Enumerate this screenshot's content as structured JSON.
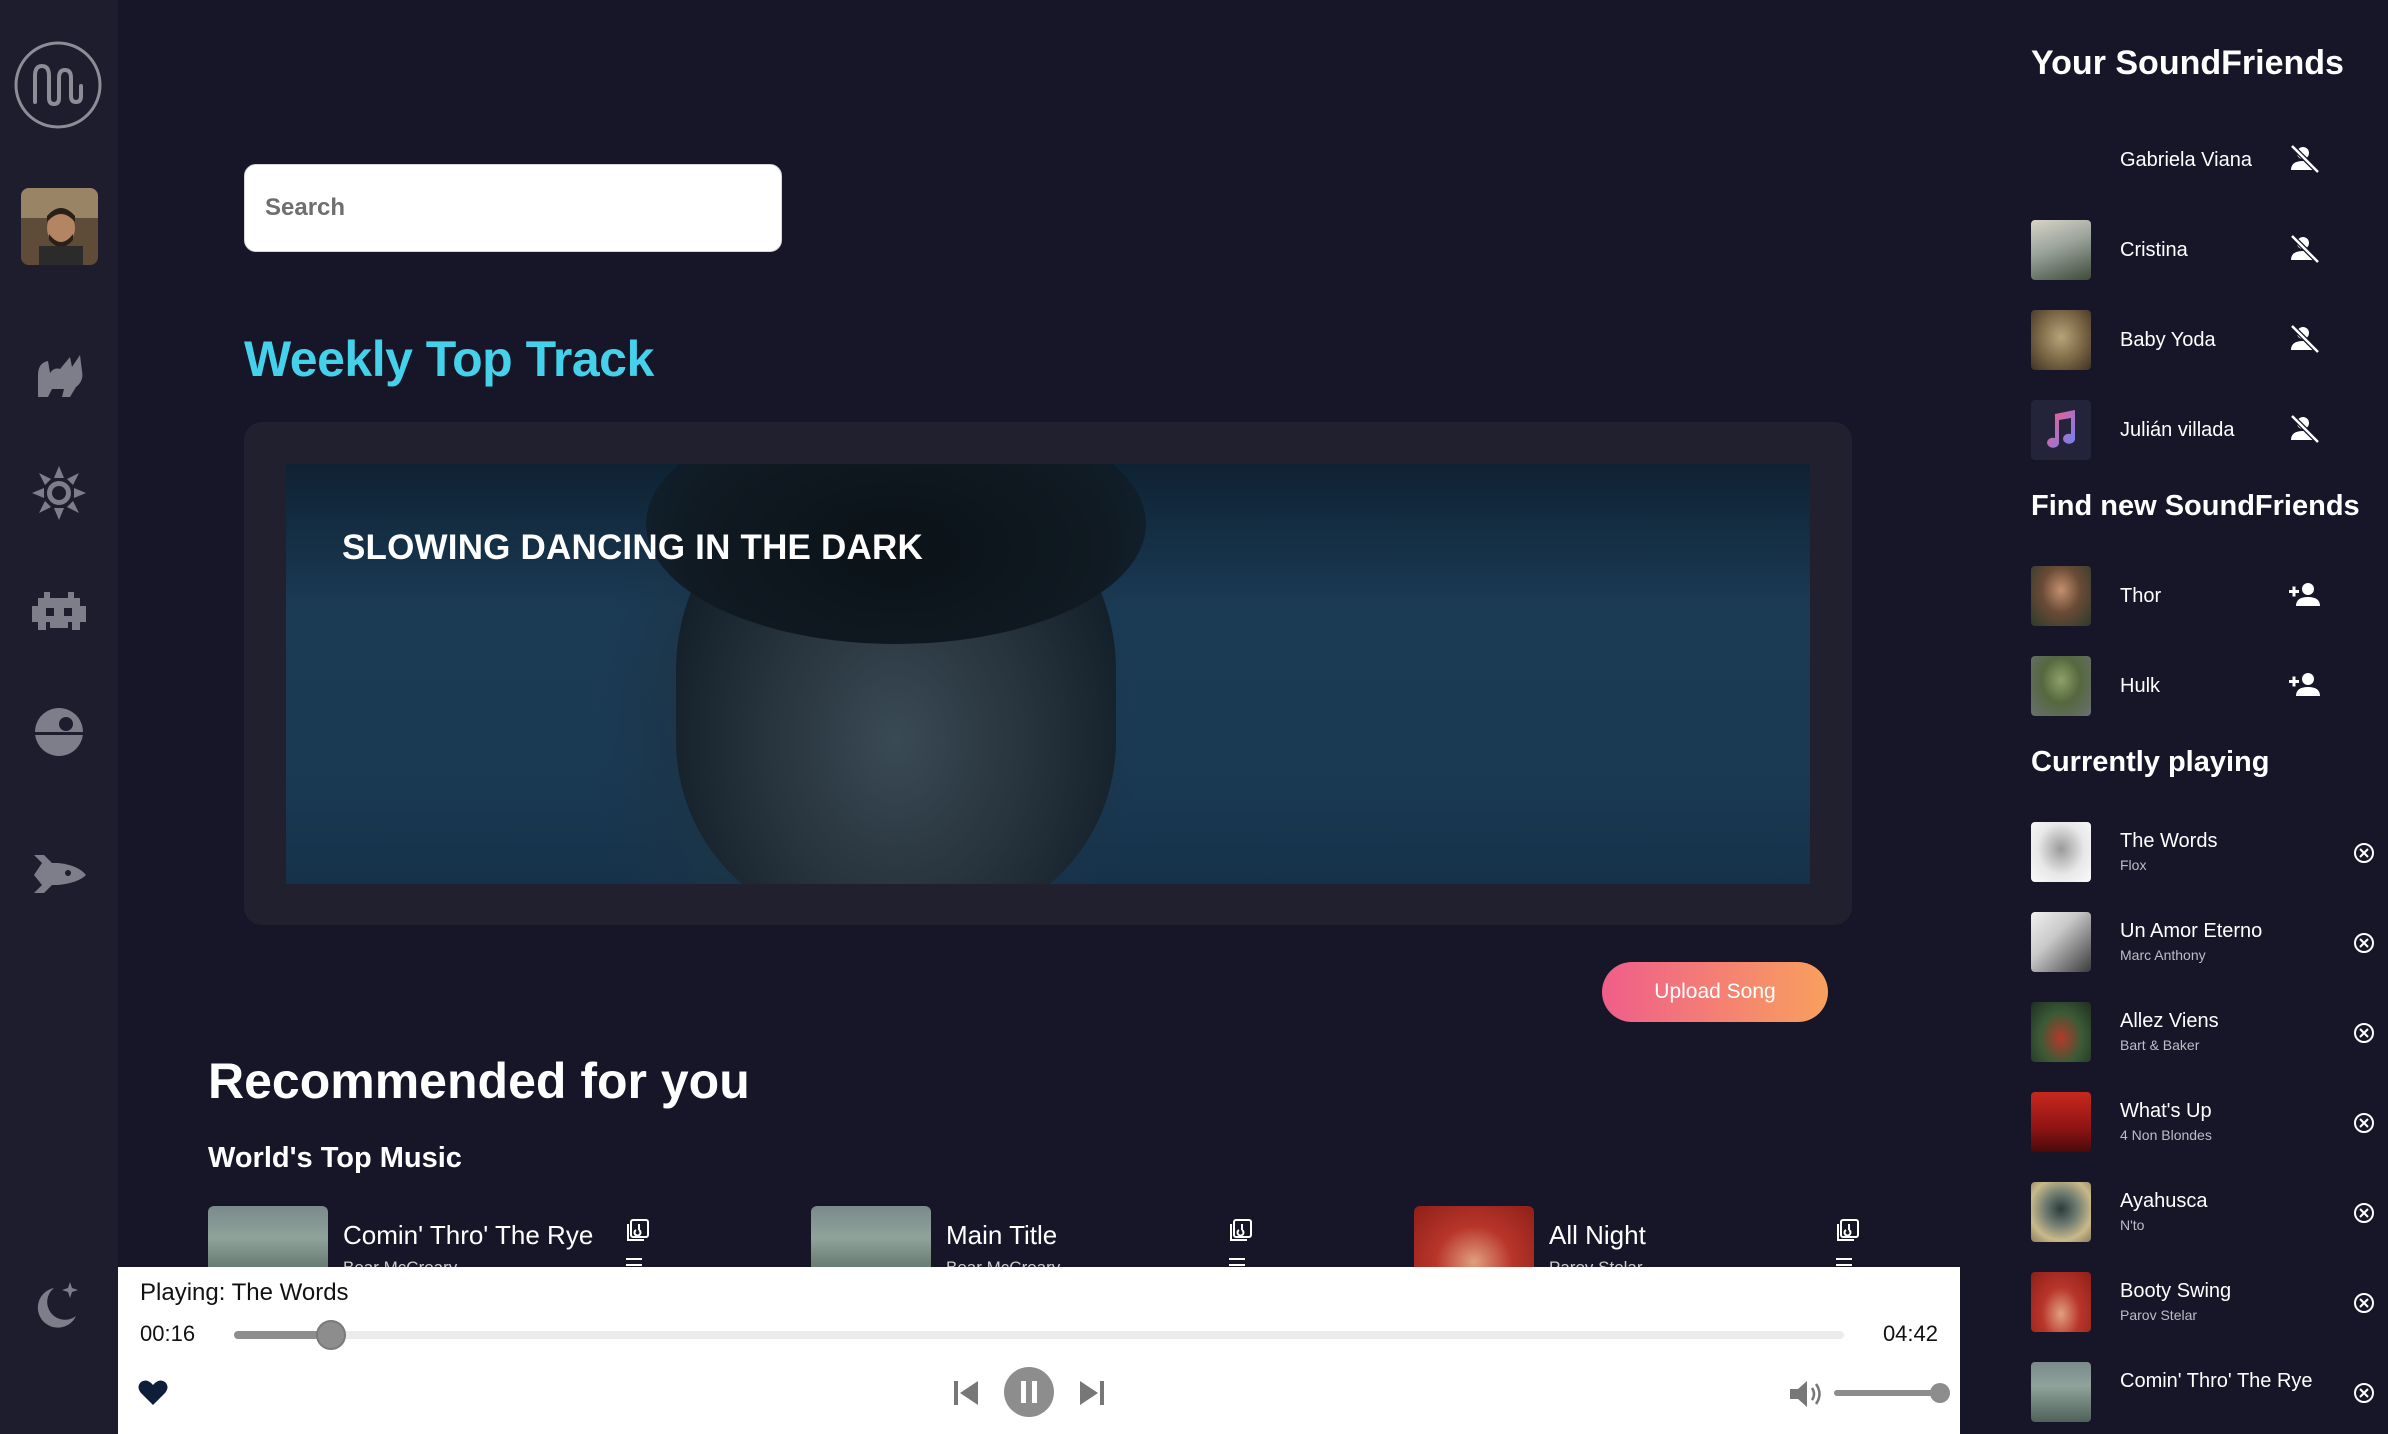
{
  "search": {
    "placeholder": "Search"
  },
  "weekly": {
    "title": "Weekly Top Track",
    "track_title": "SLOWING DANCING IN THE DARK"
  },
  "upload_label": "Upload Song",
  "recommended": {
    "title": "Recommended for you",
    "subtitle": "World's Top Music",
    "tracks": [
      {
        "title": "Comin' Thro' The Rye",
        "artist": "Bear McCreary"
      },
      {
        "title": "Main Title",
        "artist": "Bear McCreary"
      },
      {
        "title": "All Night",
        "artist": "Parov Stelar"
      }
    ]
  },
  "player": {
    "now_playing": "Playing: The Words",
    "current_time": "00:16",
    "total_time": "04:42",
    "progress": 0.06,
    "volume": 1.0
  },
  "friends": {
    "title": "Your SoundFriends",
    "items": [
      {
        "name": "Gabriela Viana"
      },
      {
        "name": "Cristina"
      },
      {
        "name": "Baby Yoda"
      },
      {
        "name": "Julián villada"
      }
    ]
  },
  "find": {
    "title": "Find new SoundFriends",
    "items": [
      {
        "name": "Thor"
      },
      {
        "name": "Hulk"
      }
    ]
  },
  "queue": {
    "title": "Currently playing",
    "items": [
      {
        "title": "The Words",
        "artist": "Flox"
      },
      {
        "title": "Un Amor Eterno",
        "artist": "Marc Anthony"
      },
      {
        "title": "Allez Viens",
        "artist": "Bart & Baker"
      },
      {
        "title": "What's Up",
        "artist": "4 Non Blondes"
      },
      {
        "title": "Ayahusca",
        "artist": "N'to"
      },
      {
        "title": "Booty Swing",
        "artist": "Parov Stelar"
      },
      {
        "title": "Comin' Thro' The Rye",
        "artist": ""
      }
    ]
  },
  "colors": {
    "accent": "#45d1ea",
    "background": "#171629",
    "sidebar": "#1e1d2d",
    "upload_start": "#ef5e8a",
    "upload_end": "#f8a05e"
  },
  "icons": [
    "logo-icon",
    "cat-icon",
    "sun-icon",
    "invader-icon",
    "death-star-icon",
    "spaceship-icon",
    "moon-icon",
    "remove-friend-icon",
    "add-friend-icon",
    "remove-circle-icon",
    "heart-icon",
    "previous-icon",
    "pause-icon",
    "next-icon",
    "volume-icon"
  ]
}
